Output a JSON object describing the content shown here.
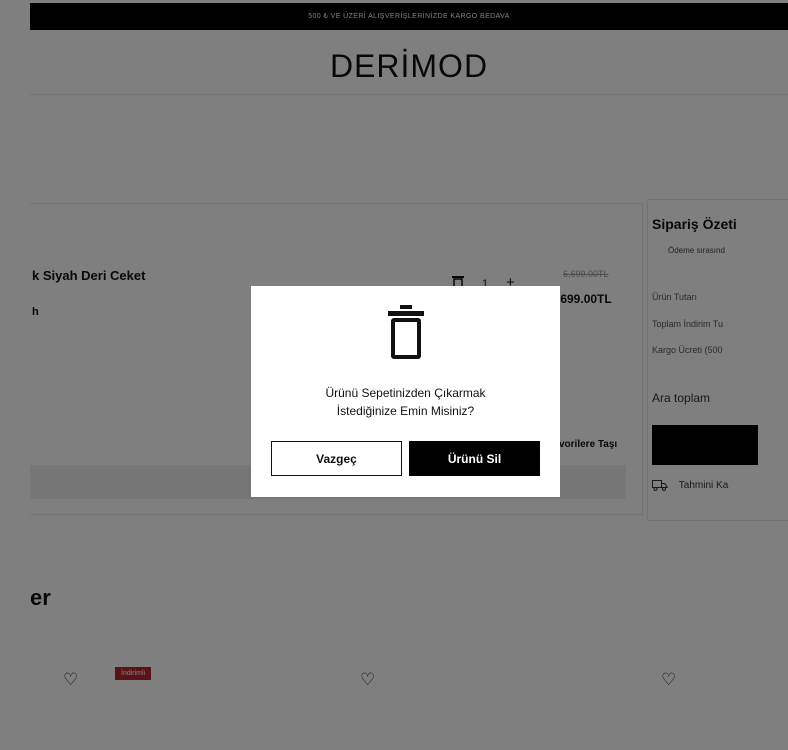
{
  "topbar": {
    "text": "500 ₺ VE ÜZERİ ALIŞVERİŞLERİNİZDE KARGO BEDAVA"
  },
  "header": {
    "logo": "DERİMOD"
  },
  "cart": {
    "product_name": "k Siyah Deri Ceket",
    "product_color": "h",
    "quantity": "1",
    "plus": "+",
    "old_price": "6,699.00TL",
    "new_price": ",699.00TL",
    "move_to_favorites": "vorilere Taşı"
  },
  "summary": {
    "title": "Sipariş Özeti",
    "note": "Ödeme sırasınd",
    "product_total": "Ürün Tutarı",
    "total_discount": "Toplam İndirim Tu",
    "shipping_fee": "Kargo Ücreti (500",
    "subtotal": "Ara toplam",
    "estimated": "Tahmini Ka"
  },
  "recommendations": {
    "title": "er",
    "badge": "İndirimli"
  },
  "modal": {
    "line1": "Ürünü Sepetinizden Çıkarmak",
    "line2": "İstediğinize Emin Misiniz?",
    "cancel_label": "Vazgeç",
    "delete_label": "Ürünü Sil",
    "icon": "trash-icon"
  },
  "colors": {
    "accent": "#000000",
    "badge": "#b3262e",
    "overlay": "rgba(0,0,0,0.5)"
  }
}
